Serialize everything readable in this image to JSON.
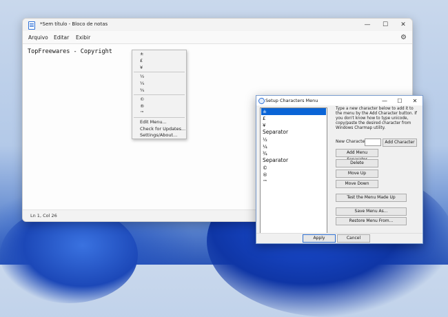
{
  "notepad": {
    "title": "*Sem título - Bloco de notas",
    "menus": [
      "Arquivo",
      "Editar",
      "Exibir"
    ],
    "content": "TopFreewares - Copyright",
    "status": "Ln 1, Col 26",
    "window_buttons": {
      "minimize": "—",
      "maximize": "☐",
      "close": "✕"
    },
    "settings_icon": "⚙"
  },
  "popup_menu": {
    "items": [
      "±",
      "£",
      "¥",
      "½",
      "¼",
      "¾",
      "©",
      "®",
      "™",
      "Edit Menu...",
      "Check for Updates...",
      "Settings/About..."
    ]
  },
  "dialog": {
    "title": "Setup Characters Menu",
    "window_buttons": {
      "minimize": "—",
      "maximize": "☐",
      "close": "✕"
    },
    "list_items": [
      "±",
      "£",
      "¥",
      "Separator",
      "½",
      "¼",
      "¾",
      "Separator",
      "©",
      "®",
      "™"
    ],
    "info": "Type a new character below to add it to the menu by the Add Character button. If you don't know how to type unicode, copy/paste the desired character from Windows Charmap utility.",
    "new_character_label": "New Character:",
    "new_character_value": "",
    "buttons": {
      "add_character": "Add Character",
      "add_separator": "Add Menu Separator",
      "delete": "Delete",
      "move_up": "Move Up",
      "move_down": "Move Down",
      "test_menu": "Test the Menu Made Up",
      "save_menu": "Save Menu As...",
      "restore_menu": "Restore Menu From...",
      "apply": "Apply",
      "cancel": "Cancel"
    }
  }
}
